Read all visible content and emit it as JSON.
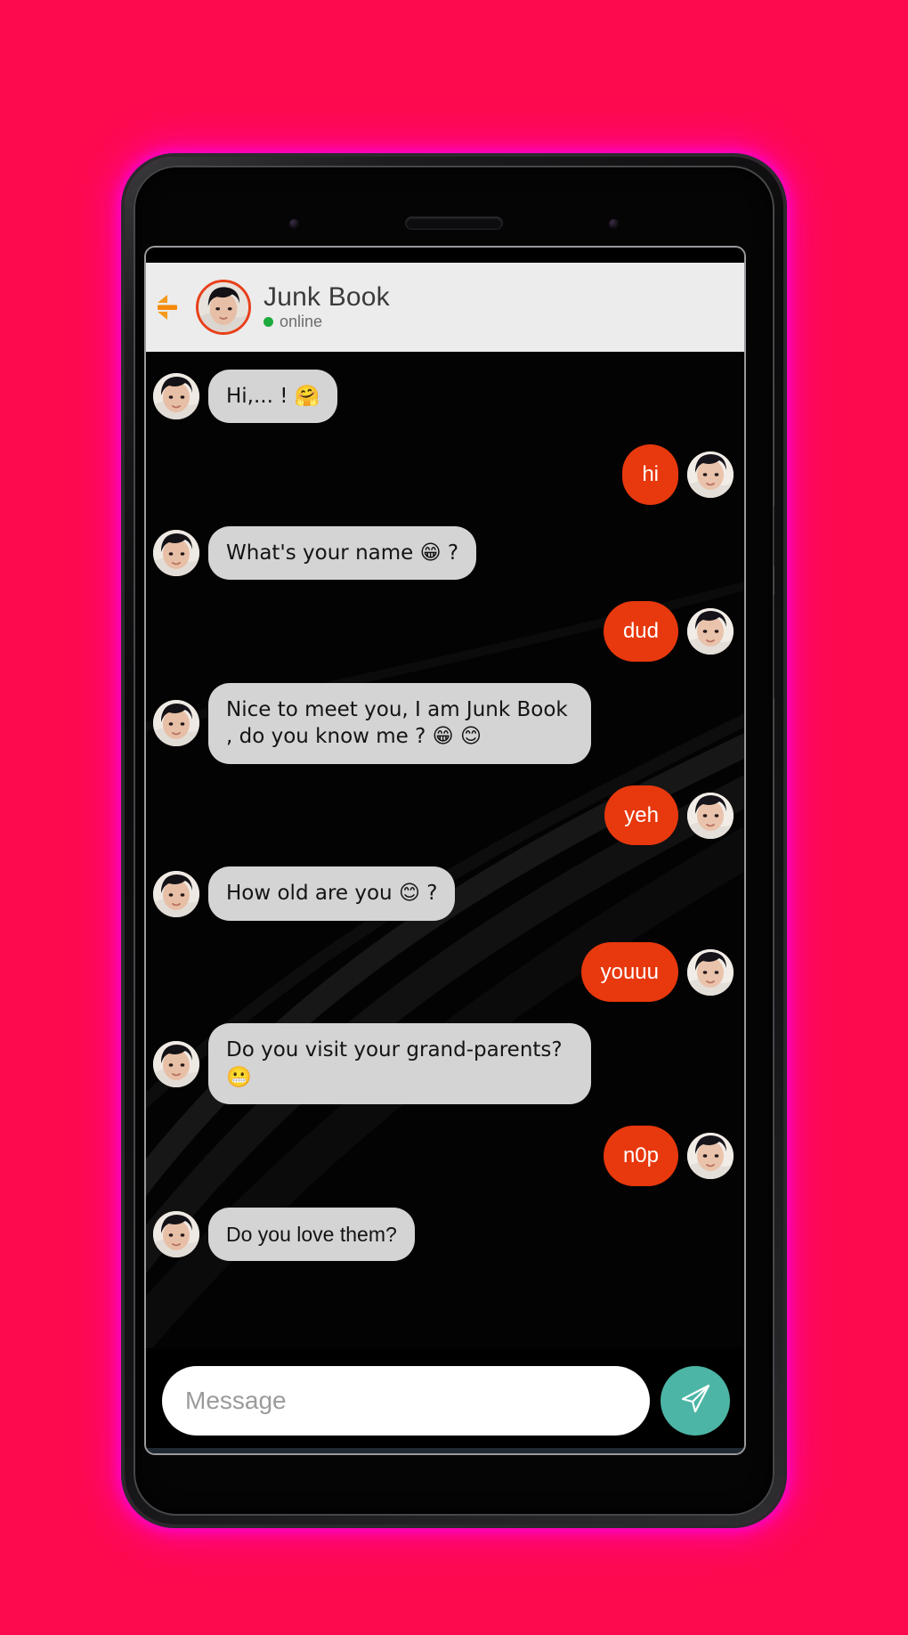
{
  "background": {
    "color": "#fd0a4e"
  },
  "device": {
    "glow_color": "#ff00e0",
    "frame_color": "#1d1d1f"
  },
  "header": {
    "back_icon": "back-arrow-icon",
    "avatar_alt": "contact-avatar",
    "title": "Junk Book",
    "status": "online",
    "status_color": "#1eab3d",
    "bg_color": "#ececec"
  },
  "colors": {
    "bot_bubble": "#d4d4d4",
    "bot_text": "#141414",
    "user_bubble": "#e8380d",
    "user_text": "#ffffff",
    "send_button": "#4cb5a5"
  },
  "messages": [
    {
      "id": 1,
      "sender": "bot",
      "text": "Hi,...  ! 🤗"
    },
    {
      "id": 2,
      "sender": "user",
      "text": "hi"
    },
    {
      "id": 3,
      "sender": "bot",
      "text": "What's your name 😁 ?"
    },
    {
      "id": 4,
      "sender": "user",
      "text": "dud"
    },
    {
      "id": 5,
      "sender": "bot",
      "text": "Nice to meet you, I am Junk Book , do you know me  ? 😁 😊"
    },
    {
      "id": 6,
      "sender": "user",
      "text": "yeh"
    },
    {
      "id": 7,
      "sender": "bot",
      "text": "How old are you 😊 ?"
    },
    {
      "id": 8,
      "sender": "user",
      "text": "youuu"
    },
    {
      "id": 9,
      "sender": "bot",
      "text": "Do you visit your grand-parents? 😬"
    },
    {
      "id": 10,
      "sender": "user",
      "text": "n0p"
    },
    {
      "id": 11,
      "sender": "bot",
      "text": "Do you love them?"
    }
  ],
  "composer": {
    "placeholder": "Message",
    "value": "",
    "send_icon": "send-paper-plane-icon"
  }
}
